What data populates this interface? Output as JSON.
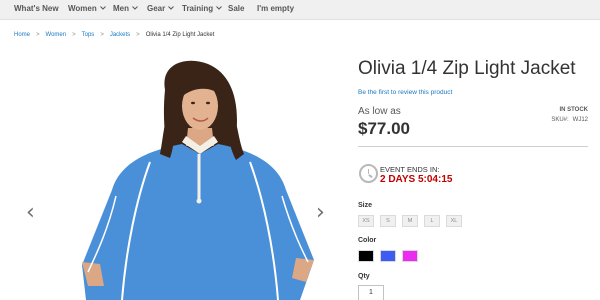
{
  "nav": {
    "items": [
      {
        "label": "What's New",
        "has_chevron": false
      },
      {
        "label": "Women",
        "has_chevron": true
      },
      {
        "label": "Men",
        "has_chevron": true
      },
      {
        "label": "Gear",
        "has_chevron": true
      },
      {
        "label": "Training",
        "has_chevron": true
      },
      {
        "label": "Sale",
        "has_chevron": false
      },
      {
        "label": "I'm empty",
        "has_chevron": false
      }
    ],
    "chevron_icon": "chevron-down-icon"
  },
  "breadcrumb": {
    "items": [
      "Home",
      "Women",
      "Tops",
      "Jackets",
      "Olivia 1/4 Zip Light Jacket"
    ],
    "separator": ">"
  },
  "gallery": {
    "prev_icon": "chevron-left-icon",
    "next_icon": "chevron-right-icon",
    "prev_glyph": "‹",
    "next_glyph": "›"
  },
  "product": {
    "title": "Olivia 1/4 Zip Light Jacket",
    "review_link": "Be the first to review this product",
    "price_prefix": "As low as",
    "price": "$77.00",
    "stock": "IN STOCK",
    "sku_label": "SKU#:",
    "sku_value": "WJ12",
    "jacket_color": "#4a90d9"
  },
  "event": {
    "icon": "clock-icon",
    "label": "EVENT ENDS IN:",
    "countdown": "2 DAYS 5:04:15",
    "countdown_color": "#c20000"
  },
  "options": {
    "size_label": "Size",
    "sizes": [
      "XS",
      "S",
      "M",
      "L",
      "XL"
    ],
    "color_label": "Color",
    "colors": [
      "#000000",
      "#3d5df2",
      "#ec2bf0"
    ],
    "qty_label": "Qty",
    "qty_value": "1"
  }
}
